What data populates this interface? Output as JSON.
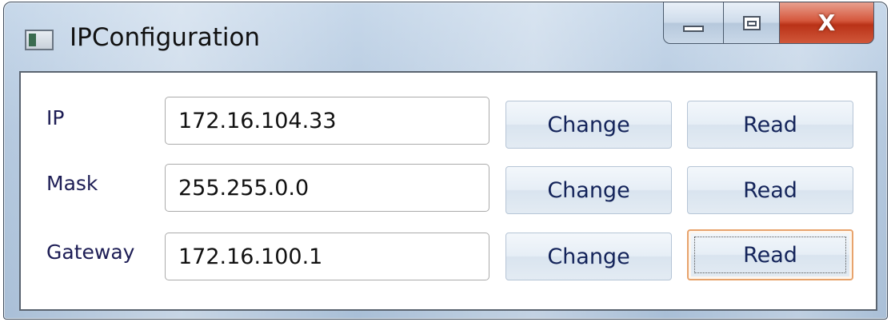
{
  "window": {
    "title": "IPConfiguration",
    "controls": {
      "minimize": "minimize",
      "maximize": "maximize",
      "close_label": "X"
    }
  },
  "rows": [
    {
      "label": "IP",
      "value": "172.16.104.33",
      "change_label": "Change",
      "read_label": "Read"
    },
    {
      "label": "Mask",
      "value": "255.255.0.0",
      "change_label": "Change",
      "read_label": "Read"
    },
    {
      "label": "Gateway",
      "value": "172.16.100.1",
      "change_label": "Change",
      "read_label": "Read"
    }
  ],
  "focused_button": "rows.2.read",
  "colors": {
    "close_button": "#c9472a",
    "label_text": "#1d1d55",
    "button_text": "#14245a",
    "focus_border": "#e8a36c"
  },
  "icons": {
    "app": "app-window-icon",
    "minimize": "minimize-icon",
    "maximize": "maximize-icon",
    "close": "close-icon"
  }
}
